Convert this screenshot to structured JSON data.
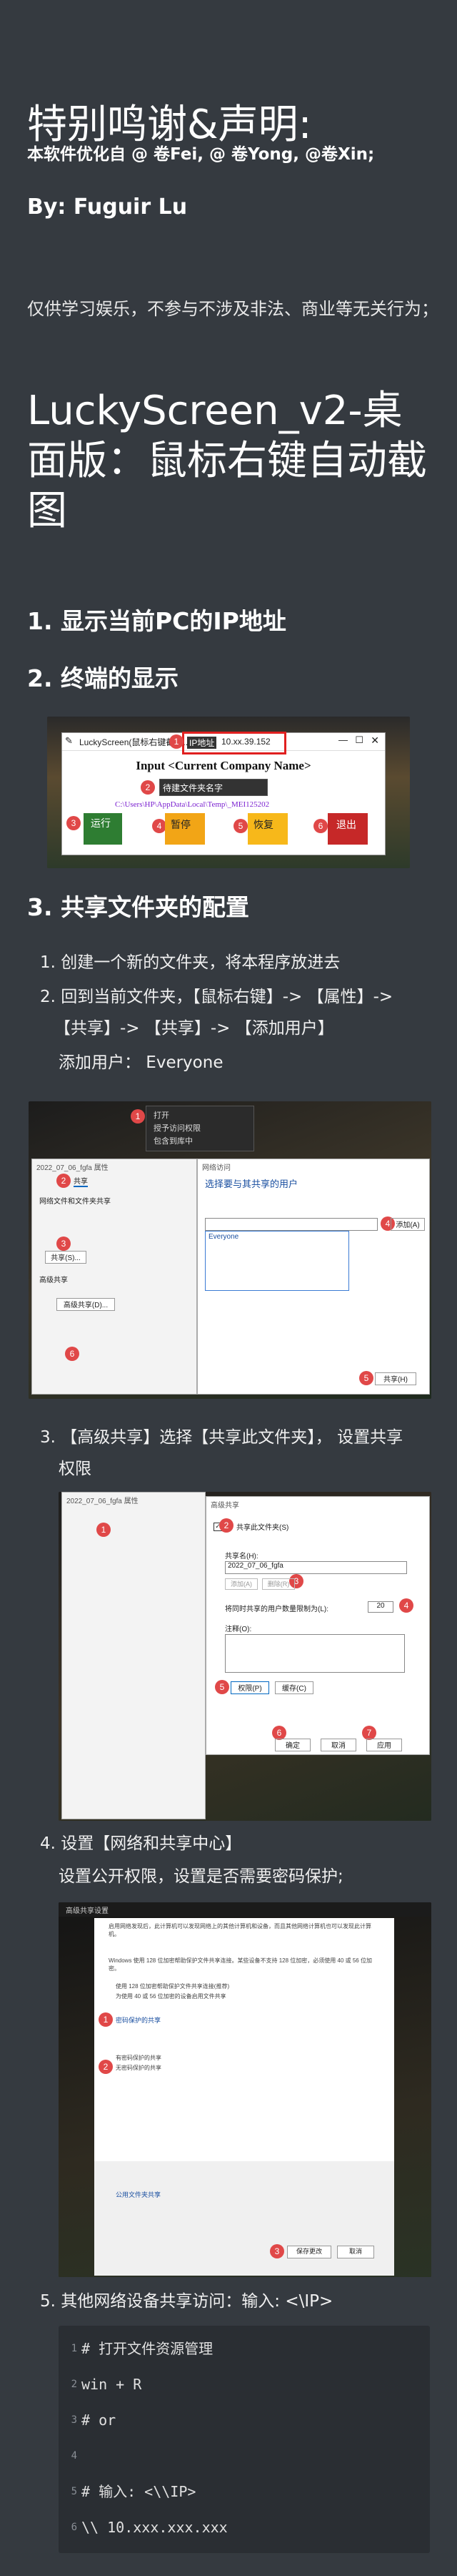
{
  "title_thanks": "特别鸣谢&声明:",
  "thanks_line": "本软件优化自 @ 卷Fei, @ 卷Yong, @卷Xin;",
  "author": "By: Fuguir Lu",
  "disclaimer": "仅供学习娱乐，不参与不涉及非法、商业等无关行为；",
  "main_title": "LuckyScreen_v2-桌面版：鼠标右键自动截图",
  "section1": "1. 显示当前PC的IP地址",
  "section2": "2. 终端的显示",
  "section3": "3. 共享文件夹的配置",
  "app_window": {
    "title": "LuckyScreen(鼠标右键截图...",
    "ip_label": "IP地址",
    "ip_value": "10.xx.39.152",
    "company_input": "Input <Current Company Name>",
    "create_folder": "待建文件夹名字",
    "path": "C:\\Users\\HP\\AppData\\Local\\Temp\\_MEI125202",
    "btn_run": "运行",
    "btn_pause": "暂停",
    "btn_resume": "恢复",
    "btn_exit": "退出"
  },
  "steps": {
    "s1": "1. 创建一个新的文件夹，将本程序放进去",
    "s2a": "2. 回到当前文件夹，【鼠标右键】-> 【属性】->",
    "s2b": "【共享】-> 【共享】-> 【添加用户】",
    "s2c": "添加用户： Everyone",
    "s3a": "3. 【高级共享】选择【共享此文件夹】， 设置共享",
    "s3b": "权限",
    "s4a": "4. 设置【网络和共享中心】",
    "s4b": "设置公开权限，设置是否需要密码保护;",
    "s5": "5. 其他网络设备共享访问：输入: <\\IP>"
  },
  "shot1": {
    "menu_open": "打开",
    "menu_share": "授予访问权限",
    "menu_include": "包含到库中",
    "props_title": "2022_07_06_fgfa 属性",
    "tab_share": "共享",
    "share_title": "网络文件和文件夹共享",
    "share_btn": "共享(S)...",
    "adv_title": "高级共享",
    "adv_btn": "高级共享(D)...",
    "dialog_title": "网络访问",
    "dialog_prompt": "选择要与其共享的用户",
    "user_everyone": "Everyone",
    "add_btn": "添加(A)",
    "share_confirm": "共享(H)"
  },
  "shot2": {
    "props_title": "2022_07_06_fgfa 属性",
    "dlg_title": "高级共享",
    "check_share": "共享此文件夹(S)",
    "share_name_label": "共享名(H):",
    "share_name": "2022_07_06_fgfa",
    "add_btn": "添加(A)",
    "remove_btn": "删除(R)",
    "limit_label": "将同时共享的用户数量限制为(L):",
    "limit_val": "20",
    "note_label": "注释(O):",
    "perm_btn": "权限(P)",
    "cache_btn": "缓存(C)",
    "ok": "确定",
    "cancel": "取消",
    "apply": "应用"
  },
  "shot3": {
    "title": "高级共享设置",
    "text1": "启用网络发现后，此计算机可以发现网络上的其他计算机和设备，而且其他网络计算机也可以发现此计算机。",
    "text2": "Windows 使用 128 位加密帮助保护文件共享连接。某些设备不支持 128 位加密，必须使用 40 或 56 位加密。",
    "opt1": "使用 128 位加密帮助保护文件共享连接(推荐)",
    "opt2": "为使用 40 或 56 位加密的设备启用文件共享",
    "pwd_title": "密码保护的共享",
    "opt3": "有密码保护的共享",
    "opt4": "无密码保护的共享",
    "pub_title": "公用文件夹共享",
    "save": "保存更改",
    "cancel": "取消"
  },
  "code_lines": [
    "# 打开文件资源管理",
    "win + R",
    "# or",
    "",
    "# 输入: <\\\\IP>",
    "\\\\ 10.xxx.xxx.xxx"
  ]
}
